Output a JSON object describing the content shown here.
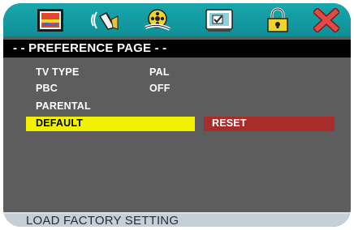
{
  "tabs": [
    {
      "icon": "picture-icon"
    },
    {
      "icon": "speaker-audio-icon"
    },
    {
      "icon": "film-reel-icon"
    },
    {
      "icon": "checkbox-screen-icon"
    },
    {
      "icon": "padlock-icon"
    },
    {
      "icon": "close-x-icon"
    }
  ],
  "page": {
    "title": "- - PREFERENCE PAGE - -"
  },
  "items": [
    {
      "label": "TV TYPE",
      "value": "PAL"
    },
    {
      "label": "PBC",
      "value": "OFF"
    },
    {
      "label": "PARENTAL",
      "value": ""
    },
    {
      "label": "DEFAULT",
      "value": ""
    }
  ],
  "submenu": {
    "option": "RESET"
  },
  "status": {
    "text": "LOAD FACTORY SETTING"
  },
  "colors": {
    "highlight": "#f2f200",
    "submenu": "#a82c2a",
    "topbar": "#13a0a6"
  }
}
